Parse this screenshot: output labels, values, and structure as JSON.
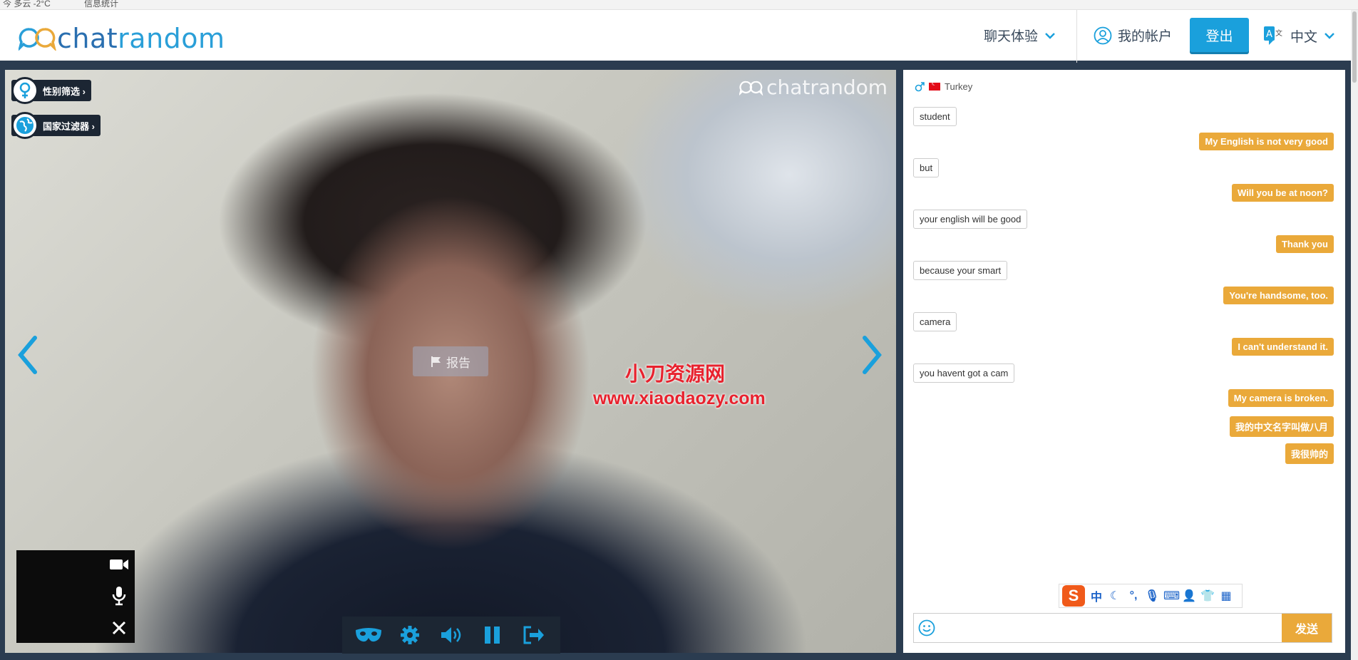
{
  "browser": {
    "weather": "今 多云 -2°C",
    "bookmark": "信息统计"
  },
  "header": {
    "logo_text_a": "chat",
    "logo_text_b": "random",
    "chat_experience": "聊天体验",
    "my_account": "我的帐户",
    "login": "登出",
    "language": "中文"
  },
  "video": {
    "watermark_logo": "chatrandom",
    "gender_filter": "性别筛选 ›",
    "country_filter": "国家过滤器 ›",
    "report": "报告",
    "overlay_line1": "小刀资源网",
    "overlay_line2": "www.xiaodaozy.com"
  },
  "chat": {
    "partner_country": "Turkey",
    "messages": [
      {
        "from": "them",
        "text": "student"
      },
      {
        "from": "me",
        "text": "My English is not very good"
      },
      {
        "from": "them",
        "text": "but"
      },
      {
        "from": "me",
        "text": "Will you be at noon?"
      },
      {
        "from": "them",
        "text": "your english will be good"
      },
      {
        "from": "me",
        "text": "Thank you"
      },
      {
        "from": "them",
        "text": "because your smart"
      },
      {
        "from": "me",
        "text": "You're handsome, too."
      },
      {
        "from": "them",
        "text": "camera"
      },
      {
        "from": "me",
        "text": "I can't understand it."
      },
      {
        "from": "them",
        "text": "you havent got a cam"
      },
      {
        "from": "me",
        "text": "My camera is broken."
      },
      {
        "from": "me",
        "text": "我的中文名字叫做八月"
      },
      {
        "from": "me",
        "text": "我很帅的"
      }
    ],
    "input_value": "",
    "send": "发送",
    "ime_logo": "S",
    "ime_mode": "中"
  },
  "colors": {
    "accent_blue": "#1aa0dc",
    "accent_orange": "#eaa93a",
    "frame_dark": "#2b3c50"
  }
}
